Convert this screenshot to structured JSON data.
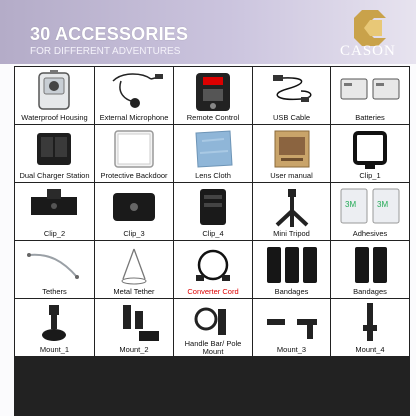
{
  "header": {
    "title": "30 ACCESSORIES",
    "subtitle": "FOR DIFFERENT ADVENTURES",
    "brand": "CASON",
    "accent_color": "#c9a24a"
  },
  "items": [
    {
      "label": "Waterproof Housing",
      "icon": "waterproof-housing-icon"
    },
    {
      "label": "External Microphone",
      "icon": "microphone-icon"
    },
    {
      "label": "Remote Control",
      "icon": "remote-control-icon"
    },
    {
      "label": "USB Cable",
      "icon": "usb-cable-icon"
    },
    {
      "label": "Batteries",
      "icon": "battery-icon"
    },
    {
      "label": "Dual Charger Station",
      "icon": "charger-icon"
    },
    {
      "label": "Protective Backdoor",
      "icon": "backdoor-icon"
    },
    {
      "label": "Lens Cloth",
      "icon": "lens-cloth-icon"
    },
    {
      "label": "User manual",
      "icon": "manual-icon"
    },
    {
      "label": "Clip_1",
      "icon": "frame-icon"
    },
    {
      "label": "Clip_2",
      "icon": "clip-icon"
    },
    {
      "label": "Clip_3",
      "icon": "clip-icon"
    },
    {
      "label": "Clip_4",
      "icon": "clip-icon"
    },
    {
      "label": "Mini Tripod",
      "icon": "tripod-icon"
    },
    {
      "label": "Adhesives",
      "icon": "adhesive-icon"
    },
    {
      "label": "Tethers",
      "icon": "tether-icon"
    },
    {
      "label": "Metal Tether",
      "icon": "metal-tether-icon"
    },
    {
      "label": "Converter Cord",
      "icon": "cord-icon",
      "color": "#d00000"
    },
    {
      "label": "Bandages",
      "icon": "bandage-icon"
    },
    {
      "label": "Bandages",
      "icon": "bandage-icon"
    },
    {
      "label": "Mount_1",
      "icon": "mount-icon"
    },
    {
      "label": "Mount_2",
      "icon": "mount-icon"
    },
    {
      "label": "Handle Bar/ Pole Mount",
      "icon": "handlebar-mount-icon"
    },
    {
      "label": "Mount_3",
      "icon": "mount-icon"
    },
    {
      "label": "Mount_4",
      "icon": "mount-icon"
    }
  ]
}
